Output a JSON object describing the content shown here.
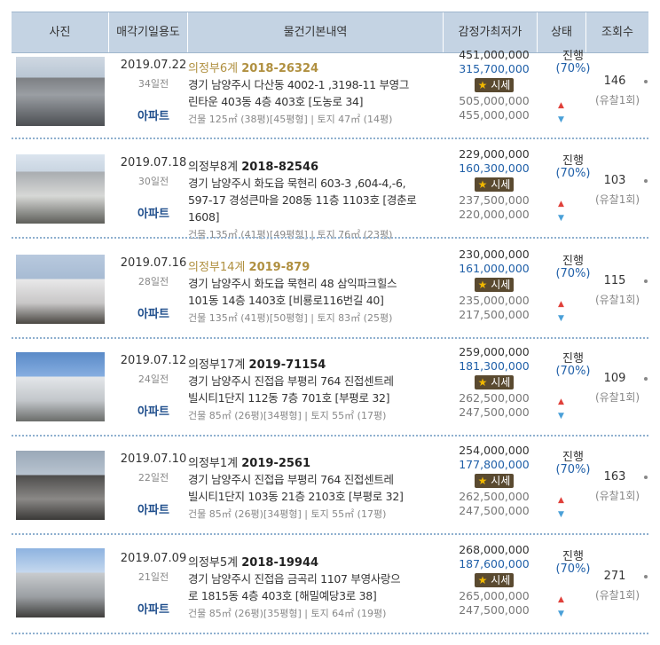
{
  "header": {
    "photo": "사진",
    "date_line1": "매각기일",
    "date_line2": "용도",
    "basic": "물건기본내역",
    "price_line1": "감정가",
    "price_line2": "최저가",
    "status": "상태",
    "views": "조회수"
  },
  "rows": [
    {
      "date": "2019.07.22",
      "days": "34일전",
      "usage": "아파트",
      "court": "의정부6계",
      "case_no": "2018-26324",
      "court_alt": true,
      "addr1": "경기 남양주시 다산동 4002-1 ,3198-11 부영그",
      "addr2": "린타운 403동 4층 403호 [도농로 34]",
      "spec": "건물 125㎡ (38평)[45평형] | 토지 47㎡ (14평)",
      "appraisal": "451,000,000",
      "minimum": "315,700,000",
      "sise": "시세",
      "high": "505,000,000",
      "low": "455,000,000",
      "status": "진행",
      "pct": "(70%)",
      "views": "146",
      "fail": "(유찰1회)"
    },
    {
      "date": "2019.07.18",
      "days": "30일전",
      "usage": "아파트",
      "court": "의정부8계",
      "case_no": "2018-82546",
      "court_alt": false,
      "addr1": "경기 남양주시 화도읍 묵현리 603-3 ,604-4,-6,",
      "addr2": "597-17 경성큰마을 208동 11층 1103호 [경춘로",
      "addr3": "1608]",
      "spec": "건물 135㎡ (41평)[49평형] | 토지 76㎡ (23평)",
      "appraisal": "229,000,000",
      "minimum": "160,300,000",
      "sise": "시세",
      "high": "237,500,000",
      "low": "220,000,000",
      "status": "진행",
      "pct": "(70%)",
      "views": "103",
      "fail": "(유찰1회)"
    },
    {
      "date": "2019.07.16",
      "days": "28일전",
      "usage": "아파트",
      "court": "의정부14계",
      "case_no": "2019-879",
      "court_alt": true,
      "addr1": "경기 남양주시 화도읍 묵현리 48 삼익파크힐스",
      "addr2": "101동 14층 1403호 [비룡로116번길 40]",
      "spec": "건물 135㎡ (41평)[50평형] | 토지 83㎡ (25평)",
      "appraisal": "230,000,000",
      "minimum": "161,000,000",
      "sise": "시세",
      "high": "235,000,000",
      "low": "217,500,000",
      "status": "진행",
      "pct": "(70%)",
      "views": "115",
      "fail": "(유찰1회)"
    },
    {
      "date": "2019.07.12",
      "days": "24일전",
      "usage": "아파트",
      "court": "의정부17계",
      "case_no": "2019-71154",
      "court_alt": false,
      "addr1": "경기 남양주시 진접읍 부평리 764 진접센트레",
      "addr2": "빌시티1단지 112동 7층 701호 [부평로 32]",
      "spec": "건물 85㎡ (26평)[34평형] | 토지 55㎡ (17평)",
      "appraisal": "259,000,000",
      "minimum": "181,300,000",
      "sise": "시세",
      "high": "262,500,000",
      "low": "247,500,000",
      "status": "진행",
      "pct": "(70%)",
      "views": "109",
      "fail": "(유찰1회)"
    },
    {
      "date": "2019.07.10",
      "days": "22일전",
      "usage": "아파트",
      "court": "의정부1계",
      "case_no": "2019-2561",
      "court_alt": false,
      "addr1": "경기 남양주시 진접읍 부평리 764 진접센트레",
      "addr2": "빌시티1단지 103동 21층 2103호 [부평로 32]",
      "spec": "건물 85㎡ (26평)[34평형] | 토지 55㎡ (17평)",
      "appraisal": "254,000,000",
      "minimum": "177,800,000",
      "sise": "시세",
      "high": "262,500,000",
      "low": "247,500,000",
      "status": "진행",
      "pct": "(70%)",
      "views": "163",
      "fail": "(유찰1회)"
    },
    {
      "date": "2019.07.09",
      "days": "21일전",
      "usage": "아파트",
      "court": "의정부5계",
      "case_no": "2018-19944",
      "court_alt": false,
      "addr1": "경기 남양주시 진접읍 금곡리 1107 부영사랑으",
      "addr2": "로 1815동 4층 403호 [해밀예당3로 38]",
      "spec": "건물 85㎡ (26평)[35평형] | 토지 64㎡ (19평)",
      "appraisal": "268,000,000",
      "minimum": "187,600,000",
      "sise": "시세",
      "high": "265,000,000",
      "low": "247,500,000",
      "status": "진행",
      "pct": "(70%)",
      "views": "271",
      "fail": "(유찰1회)"
    }
  ],
  "colors": {
    "header_bg": "#c4d3e3",
    "link_blue": "#1f5fa8",
    "alt_gold": "#b09040"
  },
  "icons": {
    "sise_badge": "star-icon",
    "up": "triangle-up-icon",
    "down": "triangle-down-icon"
  }
}
